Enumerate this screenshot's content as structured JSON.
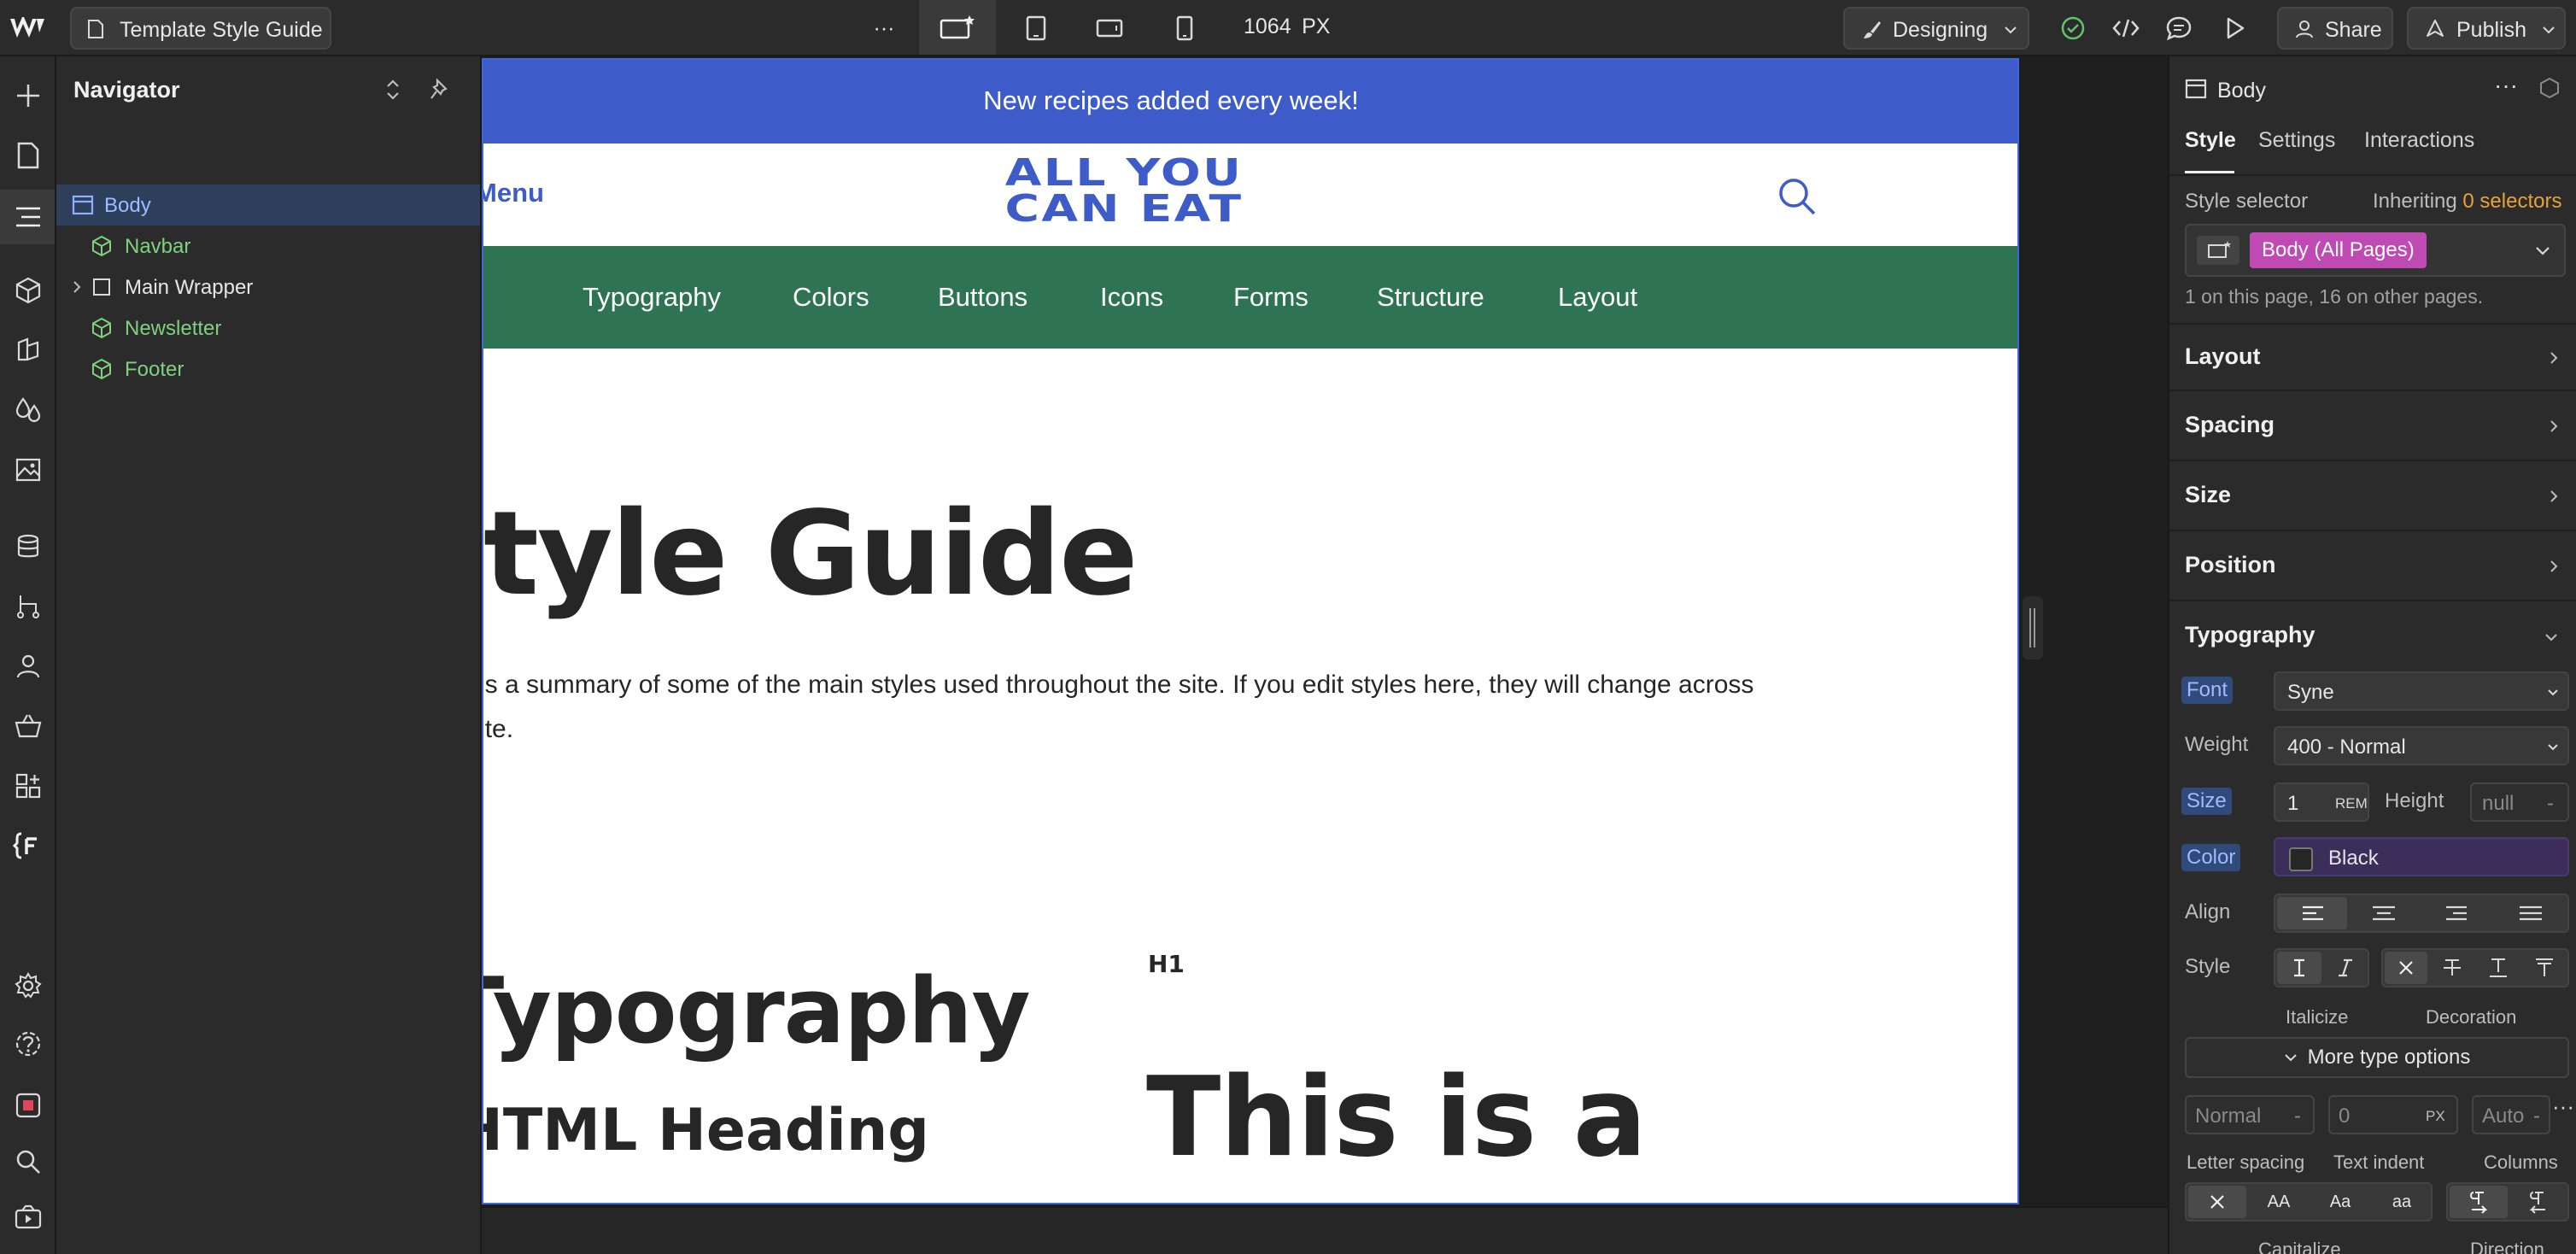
{
  "topbar": {
    "page_name": "Template Style Guide",
    "more": "···",
    "width_value": "1064",
    "width_unit": "PX",
    "mode": "Designing",
    "share": "Share",
    "publish": "Publish"
  },
  "navigator": {
    "title": "Navigator",
    "items": [
      {
        "label": "Body",
        "kind": "body",
        "selected": true
      },
      {
        "label": "Navbar",
        "kind": "component"
      },
      {
        "label": "Main Wrapper",
        "kind": "element"
      },
      {
        "label": "Newsletter",
        "kind": "component"
      },
      {
        "label": "Footer",
        "kind": "component"
      }
    ]
  },
  "page": {
    "banner": "New recipes added every week!",
    "menu_label": "Menu",
    "logo_line1": "ALL YOU",
    "logo_line2": "CAN EAT",
    "nav_items": [
      "Typography",
      "Colors",
      "Buttons",
      "Icons",
      "Forms",
      "Structure",
      "Layout"
    ],
    "hero_title": "Style Guide",
    "intro_line1": "This is a summary of some of the main styles used throughout the site. If you edit styles here, they will change across",
    "intro_line2": "the site.",
    "section_title": "Typography",
    "html_heading": "HTML Heading",
    "h1_tag": "H1",
    "h1_sample": "This is a"
  },
  "style_panel": {
    "element": "Body",
    "tabs": [
      "Style",
      "Settings",
      "Interactions"
    ],
    "style_selector_label": "Style selector",
    "inheriting_text": "Inheriting",
    "inheriting_count": "0 selectors",
    "selector_chip": "Body (All Pages)",
    "usage_note": "1 on this page, 16 on other pages.",
    "sections": [
      "Layout",
      "Spacing",
      "Size",
      "Position",
      "Typography"
    ],
    "font_label": "Font",
    "font_value": "Syne",
    "weight_label": "Weight",
    "weight_value": "400 - Normal",
    "size_label": "Size",
    "size_value": "1",
    "size_unit": "REM",
    "height_label": "Height",
    "height_value": "null",
    "height_unit": "-",
    "color_label": "Color",
    "color_value": "Black",
    "align_label": "Align",
    "style_label": "Style",
    "italicize_label": "Italicize",
    "decoration_label": "Decoration",
    "more_type_options": "More type options",
    "letter_spacing_value": "Normal",
    "letter_spacing_unit": "-",
    "text_indent_value": "0",
    "text_indent_unit": "PX",
    "columns_value": "Auto",
    "columns_unit": "-",
    "letter_spacing_label": "Letter spacing",
    "text_indent_label": "Text indent",
    "columns_label": "Columns",
    "case_options": [
      "AA",
      "Aa",
      "aa"
    ],
    "capitalize_label": "Capitalize",
    "direction_label": "Direction"
  },
  "colors": {
    "accent_blue": "#3d5bc9",
    "nav_green": "#2f7452",
    "chip_pink": "#c04ab3",
    "warning_orange": "#e7a23c",
    "component_green": "#7fd17f"
  }
}
